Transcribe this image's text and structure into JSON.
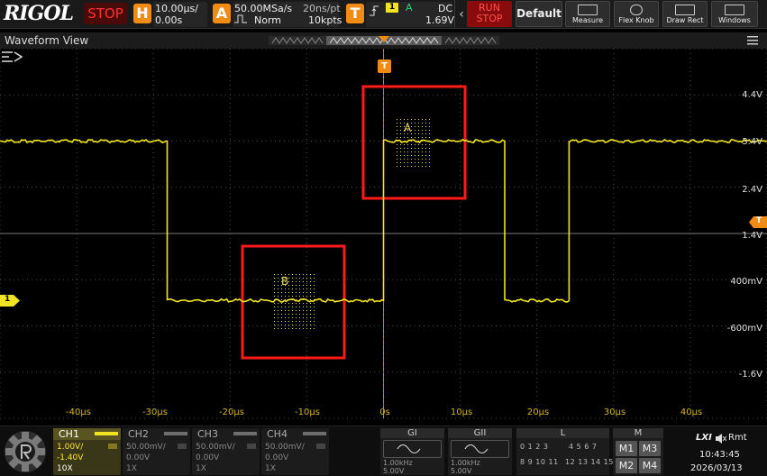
{
  "brand": "RIGOL",
  "run_state": "STOP",
  "horizontal": {
    "badge": "H",
    "time_base": "10.00µs/",
    "offset": "0.00s"
  },
  "acquire": {
    "badge": "A",
    "sample_rate": "50.00MSa/s",
    "mode": "Norm",
    "sample_period": "20ns/pt",
    "memory_depth": "10kpts"
  },
  "trigger": {
    "badge": "T",
    "source_badge": "1",
    "sweep": "A",
    "coupling": "DC",
    "level": "1.69V"
  },
  "toolbar": {
    "run_stop_line1": "RUN",
    "run_stop_line2": "STOP",
    "default_label": "Default",
    "measure_label": "Measure",
    "flex_knob_label": "Flex Knob",
    "draw_rect_label": "Draw Rect",
    "windows_label": "Windows"
  },
  "waveform_view": {
    "title": "Waveform View"
  },
  "markers": {
    "trigger_position": "T",
    "trigger_level": "T",
    "channel1": "1"
  },
  "voltage_labels": [
    "4.4V",
    "3.4V",
    "2.4V",
    "1.4V",
    "400mV",
    "-600mV",
    "-1.6V"
  ],
  "time_labels": [
    "-40µs",
    "-30µs",
    "-20µs",
    "-10µs",
    "0s",
    "10µs",
    "20µs",
    "30µs",
    "40µs"
  ],
  "zones": {
    "a_label": "A",
    "b_label": "B",
    "zone_color": "#ff1a1a"
  },
  "channels": [
    {
      "name": "CH1",
      "scale": "1.00V/",
      "offset": "-1.40V",
      "probe": "10X",
      "active": true
    },
    {
      "name": "CH2",
      "scale": "50.00mV/",
      "offset": "0.00V",
      "probe": "1X",
      "active": false
    },
    {
      "name": "CH3",
      "scale": "50.00mV/",
      "offset": "0.00V",
      "probe": "1X",
      "active": false
    },
    {
      "name": "CH4",
      "scale": "50.00mV/",
      "offset": "0.00V",
      "probe": "1X",
      "active": false
    }
  ],
  "generators": [
    {
      "name": "GI",
      "freq": "1.00kHz",
      "amp": "5.00V"
    },
    {
      "name": "GII",
      "freq": "1.00kHz",
      "amp": "5.00V"
    }
  ],
  "logic": {
    "name": "L",
    "row1": "0  1  2  3",
    "row1b": "4  5  6  7",
    "row2": "8  9 10 11",
    "row2b": "12 13 14 15"
  },
  "math": {
    "name": "M",
    "cells": [
      "M1",
      "M3",
      "M2",
      "M4"
    ]
  },
  "status": {
    "lxi": "LXI",
    "rmt": "Rmt",
    "time": "10:43:45",
    "date": "2026/03/13"
  },
  "colors": {
    "ch1": "#f2e420",
    "accent_orange": "#f08c14",
    "grid": "#4a4a4a"
  },
  "chart_data": {
    "type": "line",
    "xlabel": "",
    "ylabel": "",
    "xlim": [
      -50,
      50
    ],
    "ylim": [
      -2.6,
      5.4
    ],
    "x_units": "µs",
    "y_units": "V",
    "series": [
      {
        "x": [
          -50,
          -28.2,
          -28.2,
          0,
          0,
          15.8,
          15.8,
          24.2,
          24.2,
          50
        ],
        "values": [
          3.4,
          3.4,
          -0.05,
          -0.05,
          3.4,
          3.4,
          -0.05,
          -0.05,
          3.4,
          3.4
        ]
      }
    ]
  }
}
